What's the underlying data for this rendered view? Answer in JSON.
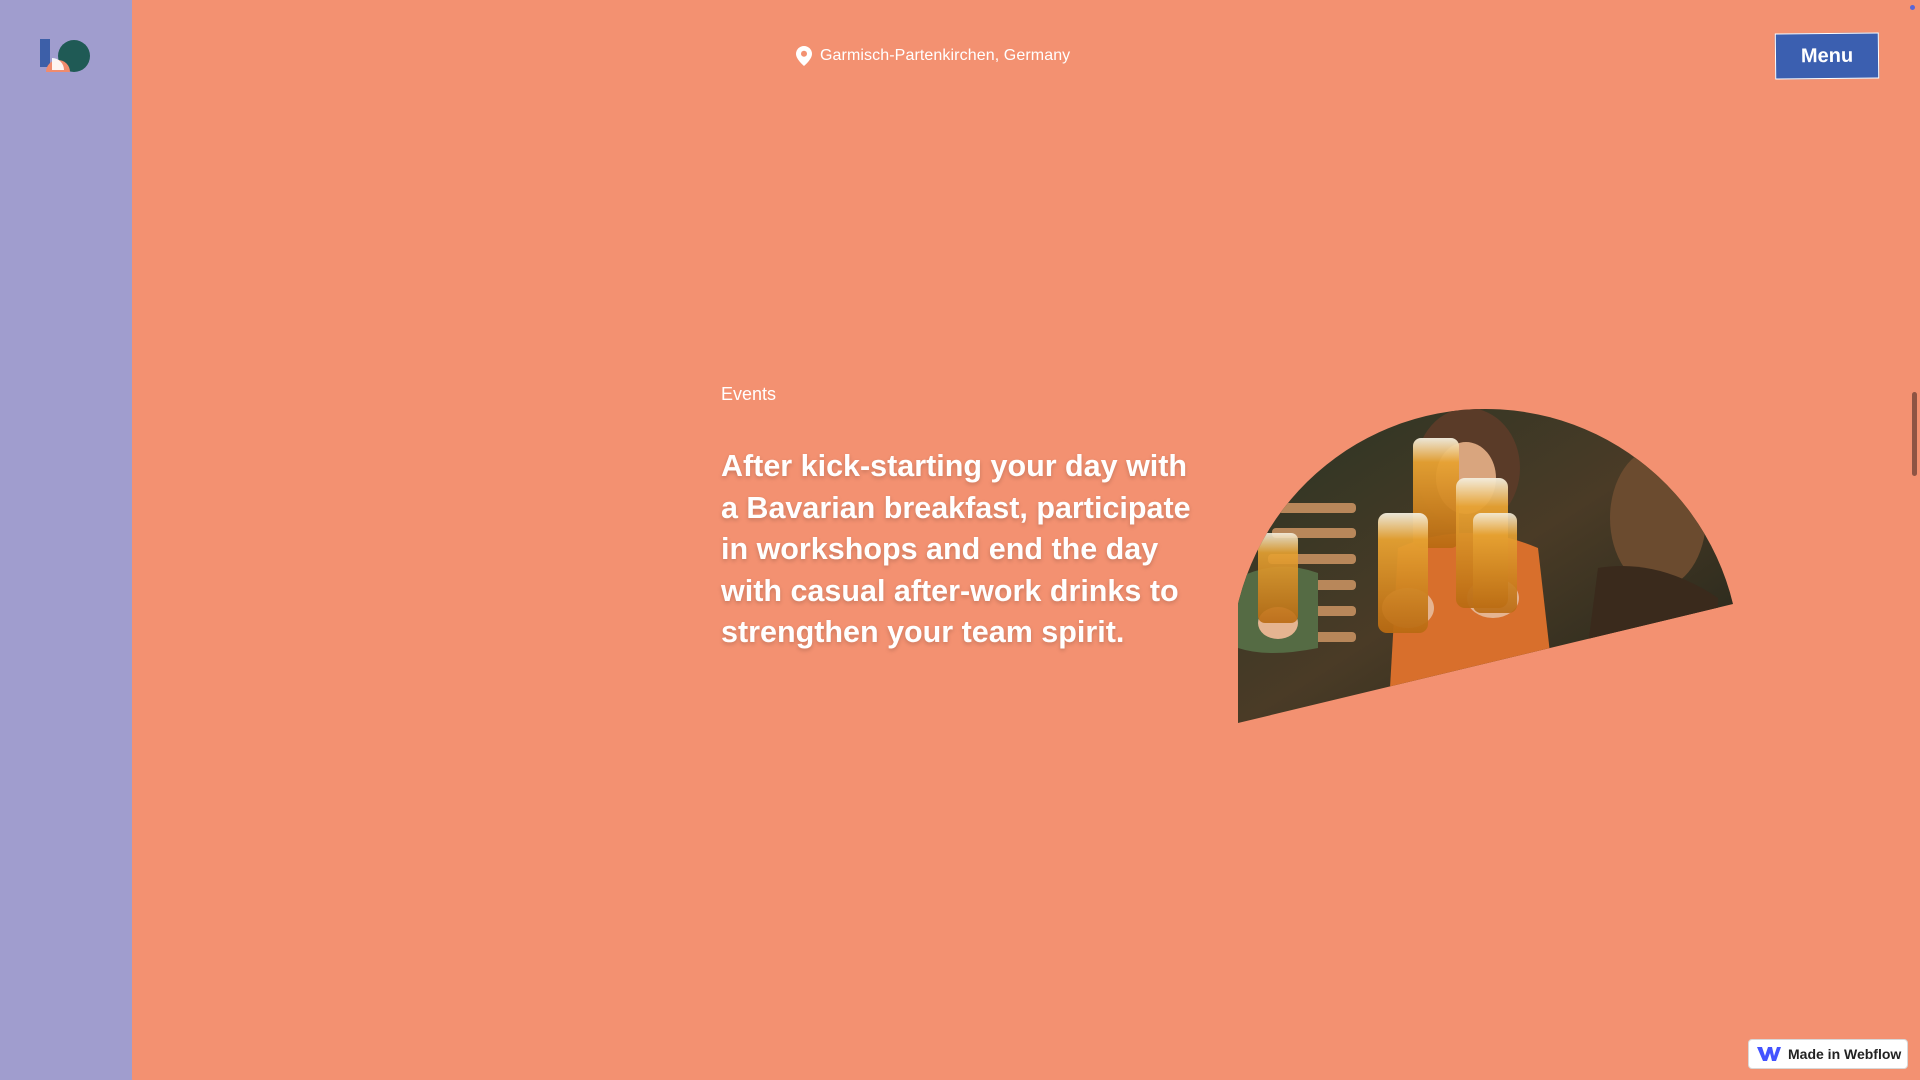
{
  "header": {
    "location_text": "Garmisch-Partenkirchen, Germany",
    "location_icon": "map-pin-icon",
    "menu_label": "Menu"
  },
  "section": {
    "eyebrow": "Events",
    "headline": "After kick-starting your day with a Bavarian breakfast, participate in workshops and end the day with casual after-work drinks to strengthen your team spirit."
  },
  "badge": {
    "label": "Made in Webflow",
    "icon": "webflow-logo-icon"
  },
  "colors": {
    "background": "#f39171",
    "sidebar": "#a09dce",
    "menu_button": "#3b5fb0",
    "text": "#ffffff",
    "logo_blue": "#3d5fa8",
    "logo_teal": "#1f5a55",
    "logo_coral": "#f08b6d"
  }
}
